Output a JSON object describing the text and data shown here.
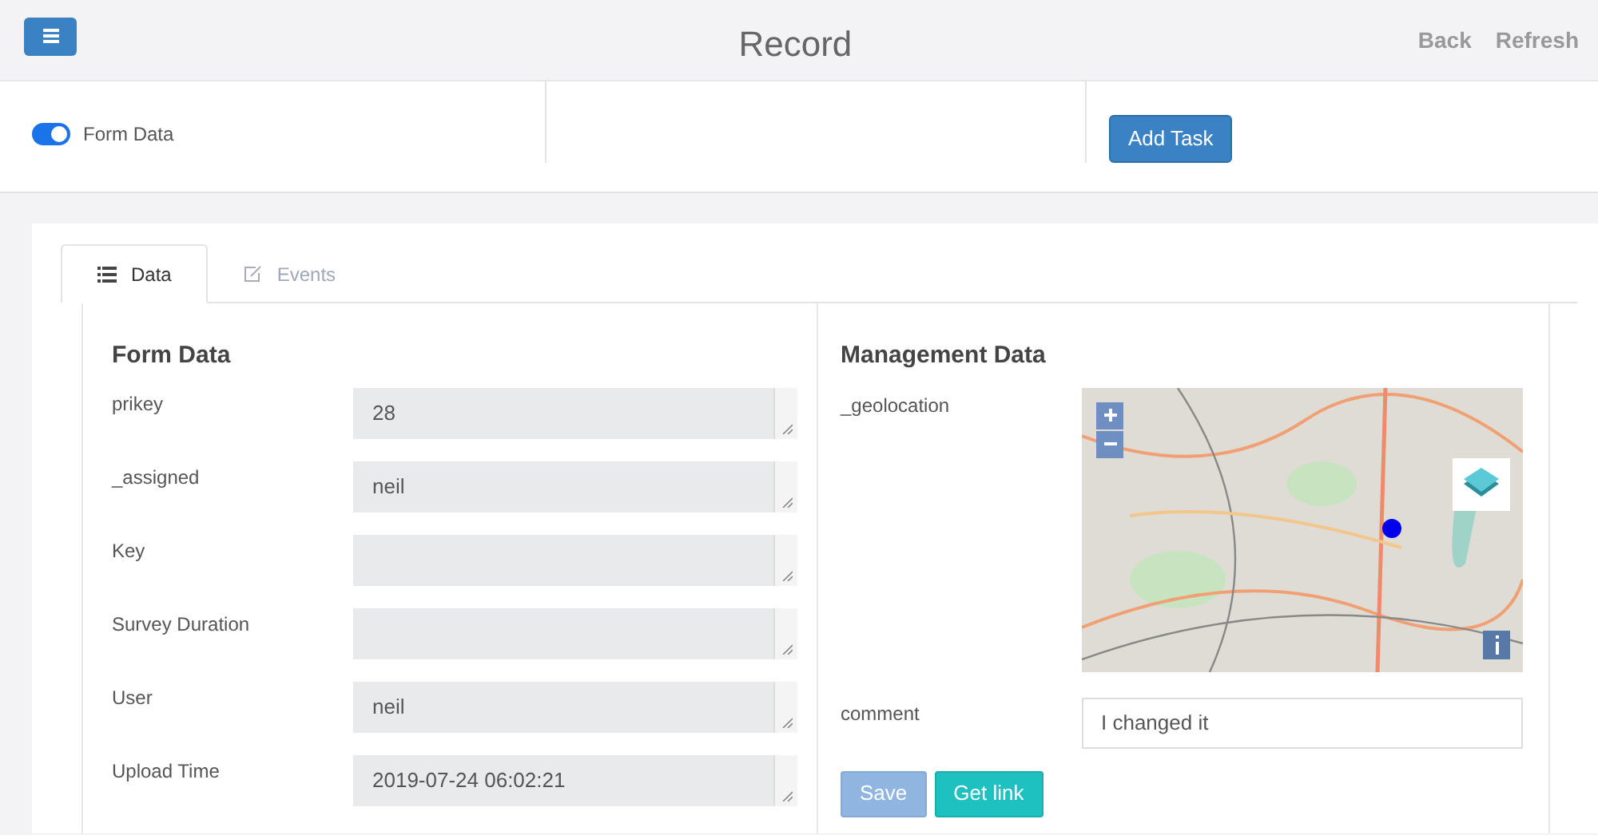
{
  "header": {
    "title": "Record",
    "links": [
      "Back",
      "Refresh"
    ]
  },
  "toolbar": {
    "toggle": {
      "label": "Form Data",
      "on": true
    },
    "add_task": "Add Task"
  },
  "tabs": [
    {
      "label": "Data",
      "selected": true
    },
    {
      "label": "Events",
      "selected": false
    }
  ],
  "form_data": {
    "title": "Form Data",
    "fields": [
      {
        "label": "prikey",
        "value": "28"
      },
      {
        "label": "_assigned",
        "value": "neil"
      },
      {
        "label": "Key"
      },
      {
        "label": "Survey Duration"
      },
      {
        "label": "User",
        "value": "neil"
      },
      {
        "label": "Upload Time",
        "value": "2019-07-24 06:02:21"
      }
    ]
  },
  "management_data": {
    "title": "Management Data",
    "geolocation_label": "_geolocation",
    "comment_label": "comment",
    "comment_value": "I changed it",
    "buttons": [
      {
        "label": "Save",
        "disabled": true
      },
      {
        "label": "Get link",
        "disabled": false
      }
    ]
  }
}
